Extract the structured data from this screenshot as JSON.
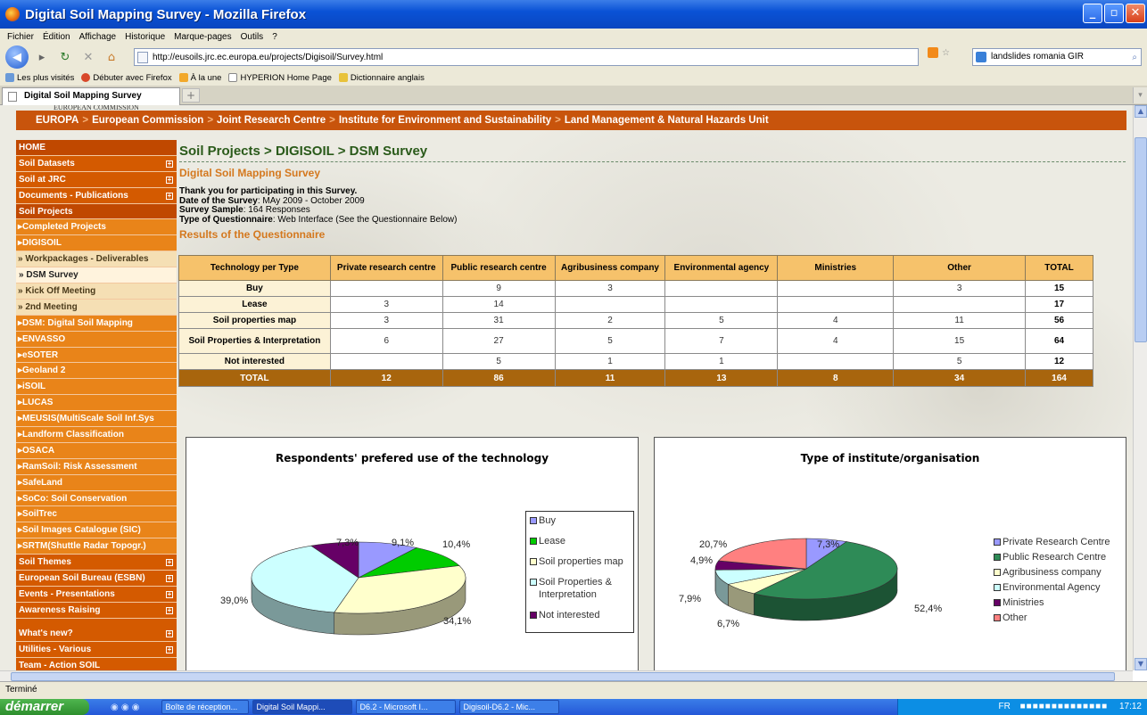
{
  "window": {
    "title": "Digital Soil Mapping Survey - Mozilla Firefox"
  },
  "menu": [
    "Fichier",
    "Édition",
    "Affichage",
    "Historique",
    "Marque-pages",
    "Outils",
    "?"
  ],
  "nav": {
    "url": "http://eusoils.jrc.ec.europa.eu/projects/Digisoil/Survey.html",
    "search_value": "landslides romania GIR"
  },
  "bookmarks": [
    "Les plus visités",
    "Débuter avec Firefox",
    "À la une",
    "HYPERION Home Page",
    "Dictionnaire anglais"
  ],
  "tab": {
    "title": "Digital Soil Mapping Survey",
    "new_tab": "+"
  },
  "page": {
    "logo_text": "EUROPEAN COMMISSION",
    "ec_bar": [
      "EUROPA",
      "European Commission",
      "Joint Research Centre",
      "Institute for Environment and Sustainability",
      "Land Management & Natural Hazards Unit"
    ],
    "sidebar": [
      {
        "label": "HOME",
        "style": "dark",
        "plus": false
      },
      {
        "label": "Soil Datasets",
        "style": "top",
        "plus": true
      },
      {
        "label": "Soil at JRC",
        "style": "top",
        "plus": true
      },
      {
        "label": "Documents - Publications",
        "style": "top",
        "plus": true
      },
      {
        "label": "Soil Projects",
        "style": "dark",
        "plus": false
      },
      {
        "label": "Completed Projects",
        "style": "sub",
        "plus": false
      },
      {
        "label": "DIGISOIL",
        "style": "sub",
        "plus": false
      },
      {
        "label": "Workpackages - Deliverables",
        "style": "sub2",
        "plus": false
      },
      {
        "label": "DSM Survey",
        "style": "active",
        "plus": false
      },
      {
        "label": "Kick Off Meeting",
        "style": "sub2",
        "plus": false
      },
      {
        "label": "2nd Meeting",
        "style": "sub2",
        "plus": false
      },
      {
        "label": "DSM: Digital Soil Mapping",
        "style": "sub",
        "plus": false
      },
      {
        "label": "ENVASSO",
        "style": "sub",
        "plus": false
      },
      {
        "label": "eSOTER",
        "style": "sub",
        "plus": false
      },
      {
        "label": "Geoland 2",
        "style": "sub",
        "plus": false
      },
      {
        "label": "iSOIL",
        "style": "sub",
        "plus": false
      },
      {
        "label": "LUCAS",
        "style": "sub",
        "plus": false
      },
      {
        "label": "MEUSIS(MultiScale Soil Inf.Sys",
        "style": "sub",
        "plus": false
      },
      {
        "label": "Landform Classification",
        "style": "sub",
        "plus": false
      },
      {
        "label": "OSACA",
        "style": "sub",
        "plus": false
      },
      {
        "label": "RamSoil: Risk Assessment",
        "style": "sub",
        "plus": false
      },
      {
        "label": "SafeLand",
        "style": "sub",
        "plus": false
      },
      {
        "label": "SoCo: Soil Conservation",
        "style": "sub",
        "plus": false
      },
      {
        "label": "SoilTrec",
        "style": "sub",
        "plus": false
      },
      {
        "label": "Soil Images Catalogue (SIC)",
        "style": "sub",
        "plus": false
      },
      {
        "label": "SRTM(Shuttle Radar Topogr.)",
        "style": "sub",
        "plus": false
      },
      {
        "label": "Soil Themes",
        "style": "top",
        "plus": true
      },
      {
        "label": "European Soil Bureau (ESBN)",
        "style": "top",
        "plus": true
      },
      {
        "label": "Events - Presentations",
        "style": "top",
        "plus": true
      },
      {
        "label": "Awareness Raising",
        "style": "top",
        "plus": true
      },
      {
        "label": "What's new?",
        "style": "top",
        "plus": true
      },
      {
        "label": "Utilities - Various",
        "style": "top",
        "plus": true
      },
      {
        "label": "Team - Action SOIL",
        "style": "top",
        "plus": false
      }
    ],
    "breadcrumb": "Soil Projects > DIGISOIL > DSM Survey",
    "heading": "Digital Soil Mapping Survey",
    "thanks": "Thank you for participating in this Survey.",
    "date_label": "Date of the Survey",
    "date_value": ": MAy 2009 - October 2009",
    "sample_label": "Survey Sample",
    "sample_value": ": 164 Responses",
    "type_label": "Type of Questionnaire",
    "type_value": ": Web Interface (See the Questionnaire Below)",
    "results_heading": "Results of the Questionnaire"
  },
  "table": {
    "headers": [
      "Technology per Type",
      "Private research centre",
      "Public research centre",
      "Agribusiness company",
      "Environmental agency",
      "Ministries",
      "Other",
      "TOTAL"
    ],
    "rows": [
      [
        "Buy",
        "",
        "9",
        "3",
        "",
        "",
        "3",
        "15"
      ],
      [
        "Lease",
        "3",
        "14",
        "",
        "",
        "",
        "",
        "17"
      ],
      [
        "Soil properties map",
        "3",
        "31",
        "2",
        "5",
        "4",
        "11",
        "56"
      ],
      [
        "Soil Properties & Interpretation",
        "6",
        "27",
        "5",
        "7",
        "4",
        "15",
        "64"
      ],
      [
        "Not interested",
        "",
        "5",
        "1",
        "1",
        "",
        "5",
        "12"
      ]
    ],
    "total_row": [
      "TOTAL",
      "12",
      "86",
      "11",
      "13",
      "8",
      "34",
      "164"
    ]
  },
  "chart_data": [
    {
      "type": "pie",
      "title": "Respondents' prefered use of the technology",
      "categories": [
        "Buy",
        "Lease",
        "Soil properties map",
        "Soil Properties & Interpretation",
        "Not interested"
      ],
      "values": [
        9.1,
        10.4,
        34.1,
        39.0,
        7.3
      ],
      "labels": [
        "9,1%",
        "10,4%",
        "34,1%",
        "39,0%",
        "7,3%"
      ],
      "colors": [
        "#9999ff",
        "#00cc00",
        "#ffffcc",
        "#ccffff",
        "#660066"
      ],
      "legend": "right"
    },
    {
      "type": "pie",
      "title": "Type of institute/organisation",
      "categories": [
        "Private Research Centre",
        "Public Research Centre",
        "Agribusiness company",
        "Environmental Agency",
        "Ministries",
        "Other"
      ],
      "values": [
        7.3,
        52.4,
        6.7,
        7.9,
        4.9,
        20.7
      ],
      "labels": [
        "7,3%",
        "52,4%",
        "6,7%",
        "7,9%",
        "4,9%",
        "20,7%"
      ],
      "colors": [
        "#9999ff",
        "#2e8b57",
        "#ffffcc",
        "#ccffff",
        "#660066",
        "#ff8080"
      ],
      "legend": "right"
    }
  ],
  "status": {
    "text": "Terminé"
  },
  "taskbar": {
    "start": "démarrer",
    "items": [
      "Boîte de réception...",
      "Digital Soil Mappi...",
      "D6.2 - Microsoft I...",
      "Digisoil-D6.2 - Mic..."
    ],
    "lang": "FR",
    "clock": "17:12"
  }
}
